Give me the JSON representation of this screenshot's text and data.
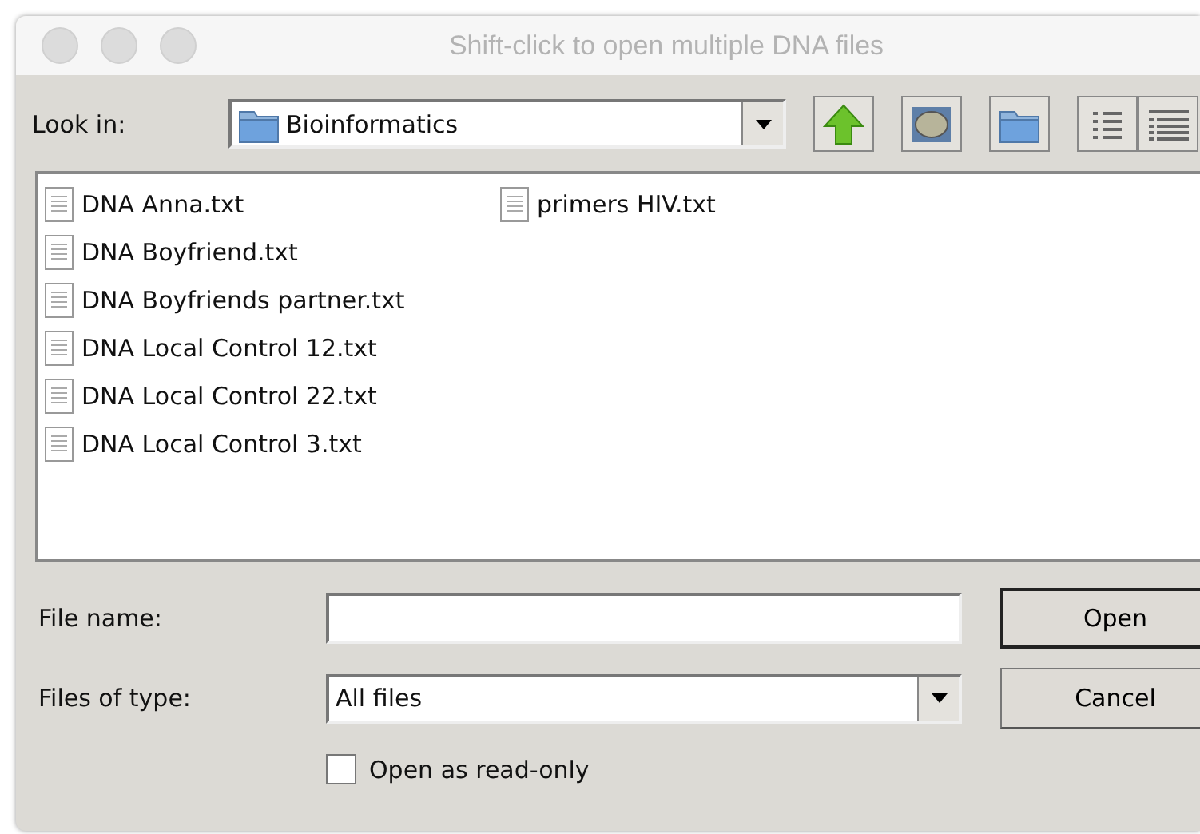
{
  "window": {
    "title": "Shift-click to open multiple DNA files"
  },
  "look_in": {
    "label": "Look in:",
    "value": "Bioinformatics"
  },
  "files": [
    "DNA Anna.txt",
    "DNA Boyfriend.txt",
    "DNA Boyfriends partner.txt",
    "DNA Local Control 12.txt",
    "DNA Local Control 22.txt",
    "DNA Local Control 3.txt",
    "primers HIV.txt"
  ],
  "file_name": {
    "label": "File name:"
  },
  "files_of_type": {
    "label": "Files of type:",
    "value": "All files"
  },
  "buttons": [
    "Open",
    "Cancel"
  ],
  "read_only": {
    "label": "Open as read-only",
    "checked": false
  }
}
